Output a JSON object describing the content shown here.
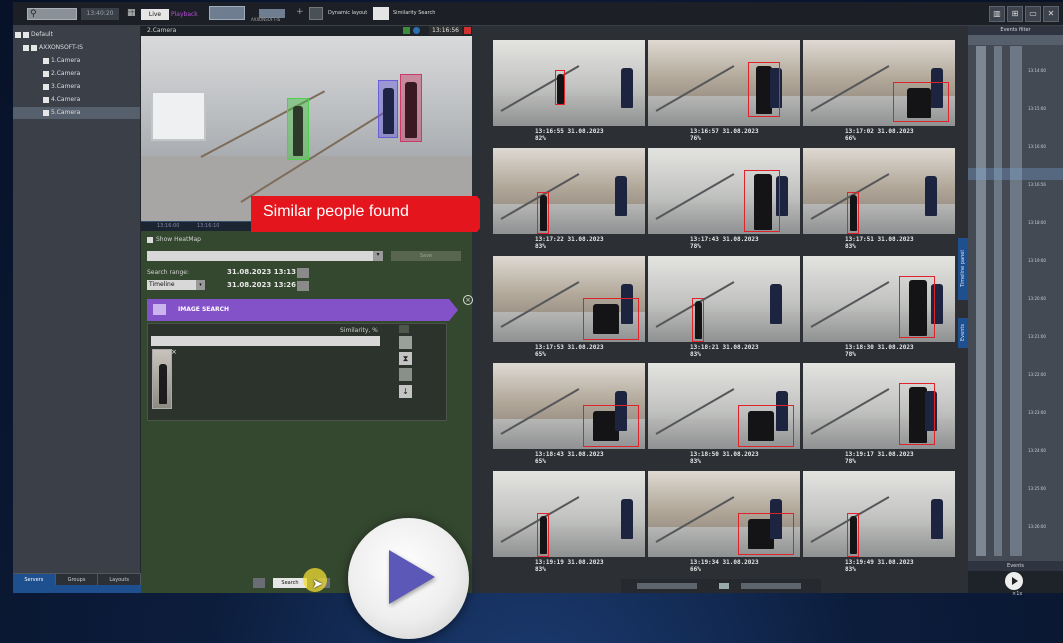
{
  "toolbar": {
    "time": "13:40:20",
    "live_label": "Live",
    "playback_label": "Playback",
    "layout_label": "AXXONSOFT-IS",
    "dynamic_layout": "Dynamic layout",
    "similarity_search": "Similarity Search",
    "plus": "+",
    "search_icon": "⚲"
  },
  "tree": {
    "root": "Default",
    "server": "AXXONSOFT-IS",
    "cameras": [
      "1.Camera",
      "2.Camera",
      "3.Camera",
      "4.Camera",
      "5.Camera"
    ],
    "selected_index": 4
  },
  "left_tabs": [
    "Servers",
    "Groups",
    "Layouts"
  ],
  "camera": {
    "name": "2.Camera",
    "time": "13:16:56",
    "timeline_start": "13:16:00",
    "timeline_end": "13:16:10"
  },
  "banner": "Similar people found",
  "form": {
    "show_heatmap": "Show HeatMap",
    "save_label": "Save",
    "search_range_label": "Search range:",
    "range_from": "31.08.2023  13:13",
    "range_to": "31.08.2023  13:26",
    "mode": "Timeline",
    "image_search_title": "IMAGE SEARCH",
    "similarity_label": "Similarity, %",
    "search_button": "Search"
  },
  "results": [
    {
      "time": "13:16:55 31.08.2023",
      "score": "82%"
    },
    {
      "time": "13:16:57 31.08.2023",
      "score": "76%"
    },
    {
      "time": "13:17:02 31.08.2023",
      "score": "66%"
    },
    {
      "time": "13:17:22 31.08.2023",
      "score": "83%"
    },
    {
      "time": "13:17:43 31.08.2023",
      "score": "78%"
    },
    {
      "time": "13:17:51 31.08.2023",
      "score": "83%"
    },
    {
      "time": "13:17:53 31.08.2023",
      "score": "65%"
    },
    {
      "time": "13:18:21 31.08.2023",
      "score": "83%"
    },
    {
      "time": "13:18:30 31.08.2023",
      "score": "78%"
    },
    {
      "time": "13:18:43 31.08.2023",
      "score": "65%"
    },
    {
      "time": "13:18:50 31.08.2023",
      "score": "83%"
    },
    {
      "time": "13:19:17 31.08.2023",
      "score": "78%"
    },
    {
      "time": "13:19:19 31.08.2023",
      "score": "83%"
    },
    {
      "time": "13:19:34 31.08.2023",
      "score": "66%"
    },
    {
      "time": "13:19:49 31.08.2023",
      "score": "83%"
    }
  ],
  "vertical_tabs": {
    "timeline": "Timeline panel",
    "events": "Events"
  },
  "timeline_panel": {
    "header": "Events filter",
    "ticks": [
      "13:14:00",
      "13:15:00",
      "13:16:00",
      "13:16:56",
      "13:18:00",
      "13:19:00",
      "13:20:00",
      "13:21:00",
      "13:22:00",
      "13:23:00",
      "13:24:00",
      "13:25:00",
      "13:26:00"
    ],
    "events_label": "Events",
    "speed": "×1x"
  }
}
